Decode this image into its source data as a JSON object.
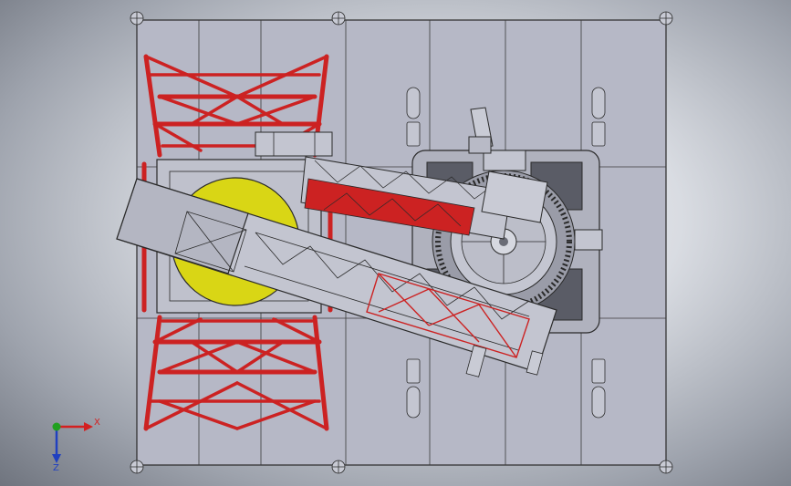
{
  "viewport": {
    "background_top": "#f4f5f7",
    "background_bottom": "#6f747e"
  },
  "model": {
    "base_color": "#b6b8c6",
    "frame_color": "#cc2222",
    "disc_color": "#d9d615",
    "boom_color": "#c3c5d0",
    "outline_color": "#2a2a2a"
  },
  "triad": {
    "x_label": "X",
    "z_label": "Z",
    "x_color": "#d42020",
    "y_color": "#20a020",
    "z_color": "#2040c0"
  }
}
